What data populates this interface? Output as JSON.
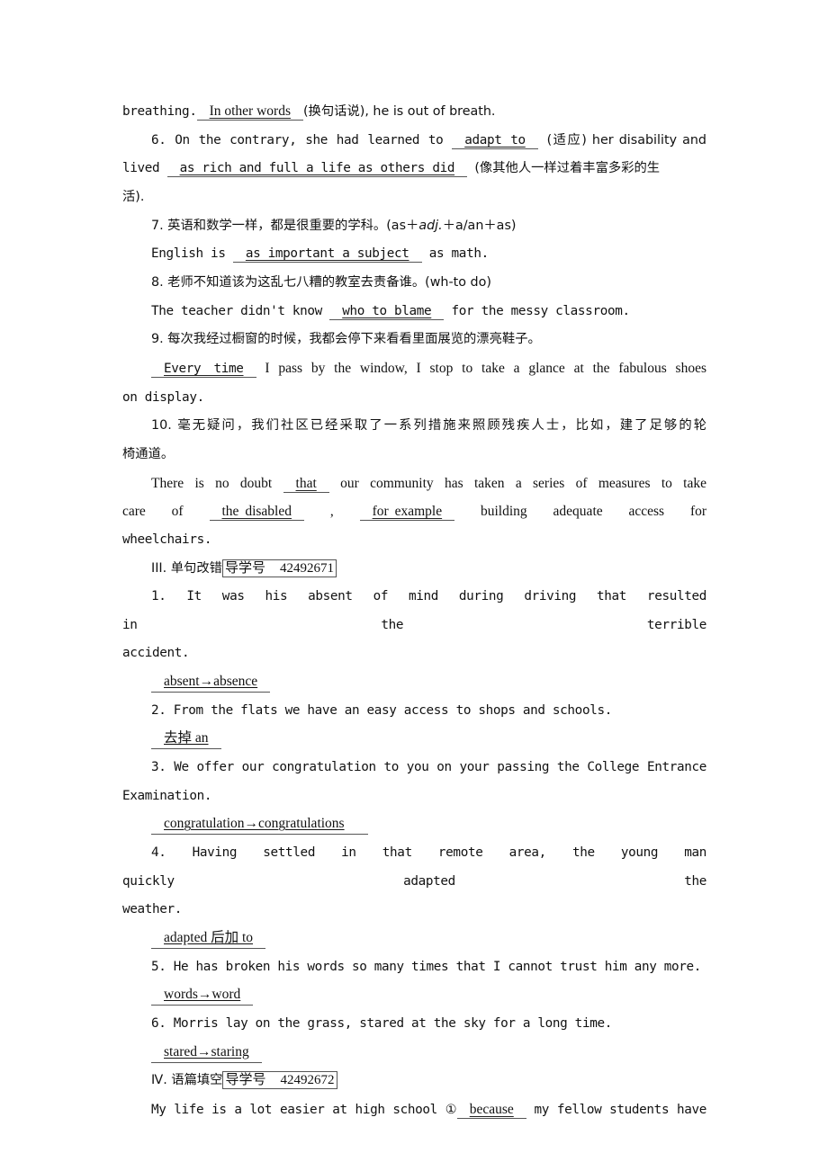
{
  "part2_translation": {
    "item5_tail": {
      "pre": "breathing.",
      "blank": "In other words",
      "post": "(换句话说), he is out of breath."
    },
    "item6": {
      "num": "6.",
      "pre": "On the contrary, she had learned to",
      "blank1": "adapt to",
      "mid": "(适应) her disability and",
      "pre2": "lived",
      "blank2": "as rich and full a life as others did",
      "post": "(像其他人一样过着丰富多彩的生",
      "wrap": "活)."
    },
    "item7": {
      "prompt": "7. 英语和数学一样，都是很重要的学科。(as＋",
      "prompt_italic": "adj.",
      "prompt_end": "＋a/an＋as)",
      "pre": "English is",
      "blank": "as important a subject",
      "post": "as math."
    },
    "item8": {
      "prompt": "8. 老师不知道该为这乱七八糟的教室去责备谁。(wh-to do)",
      "pre": "The teacher didn't know",
      "blank": "who to blame",
      "post": "for the messy classroom."
    },
    "item9": {
      "prompt": "9. 每次我经过橱窗的时候，我都会停下来看看里面展览的漂亮鞋子。",
      "blank": "Every time",
      "post": "I pass by the window, I stop to take a glance at the fabulous shoes",
      "wrap": "on display."
    },
    "item10": {
      "prompt": "10. 毫无疑问，我们社区已经采取了一系列措施来照顾残疾人士，比如，建了足够的轮",
      "prompt_wrap": "椅通道。",
      "pre": "There is no doubt",
      "blank1": "that",
      "mid": "our community has taken a series of measures to take",
      "pre2": "care of",
      "blank2": "the disabled",
      "comma": ",",
      "blank3": "for example",
      "post": "building adequate access for",
      "wrap": "wheelchairs."
    }
  },
  "part3_correction": {
    "heading": "III. 单句改错",
    "ref_label": "导学号",
    "ref_number": "42492671",
    "items": [
      {
        "num": "1.",
        "line1": "It was his absent of mind during driving that resulted in the terrible",
        "line2": "accident.",
        "answer": "absent→absence"
      },
      {
        "num": "2.",
        "line1": "From the flats we have an easy access to shops and schools.",
        "line2": "",
        "answer": "去掉 an"
      },
      {
        "num": "3.",
        "line1": "We offer our congratulation to you on your passing the College Entrance",
        "line2": "Examination.",
        "answer": "congratulation→congratulations"
      },
      {
        "num": "4.",
        "line1": "Having settled in that remote area, the young man quickly adapted the",
        "line2": "weather.",
        "answer": "adapted 后加 to"
      },
      {
        "num": "5.",
        "line1": "He has broken his words so many times that I cannot trust him any more.",
        "line2": "",
        "answer": "words→word"
      },
      {
        "num": "6.",
        "line1": "Morris lay on the grass, stared at the sky for a long time.",
        "line2": "",
        "answer": "stared→staring"
      }
    ]
  },
  "part4_cloze": {
    "heading": "Ⅳ. 语篇填空",
    "ref_label": "导学号",
    "ref_number": "42492672",
    "line1_pre": "My life is a lot easier at high school",
    "blank_marker": "①",
    "blank1": "because",
    "line1_post": "my fellow students have"
  }
}
